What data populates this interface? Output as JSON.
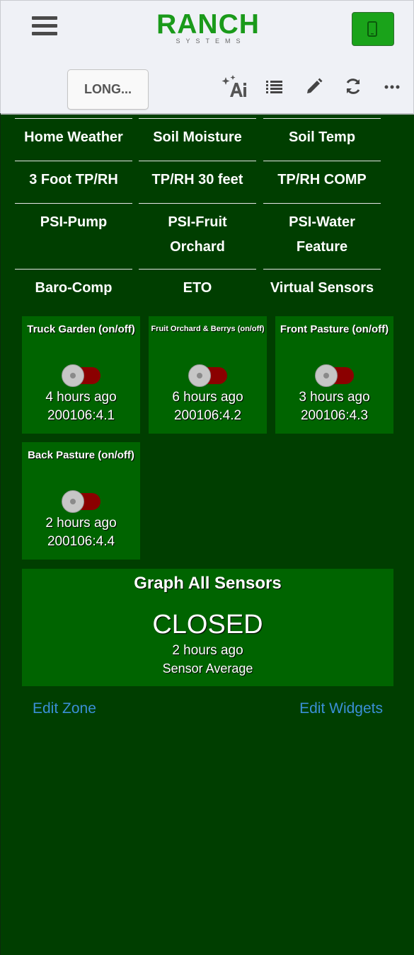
{
  "header": {
    "logo_main": "RANCH",
    "logo_sub": "SYSTEMS",
    "menu_icon": "hamburger-icon",
    "phone_icon": "mobile-phone-icon",
    "colors": {
      "logo": "#1a9a1a",
      "phone_button": "#1aa31a"
    }
  },
  "toolbar": {
    "selector_label": "LONG...",
    "icons": [
      "ai-sparkle-icon",
      "list-icon",
      "pencil-icon",
      "refresh-icon",
      "more-icon"
    ]
  },
  "nav": [
    [
      "Home Weather",
      "Soil Moisture",
      "Soil Temp"
    ],
    [
      "3 Foot TP/RH",
      "TP/RH 30 feet",
      "TP/RH COMP"
    ],
    [
      "PSI-Pump",
      "PSI-Fruit Orchard",
      "PSI-Water Feature"
    ],
    [
      "Baro-Comp",
      "ETO",
      "Virtual Sensors"
    ]
  ],
  "widgets": [
    {
      "title": "Truck Garden (on/off)",
      "state": "off",
      "time": "4 hours ago",
      "id": "200106:4.1"
    },
    {
      "title": "Fruit Orchard & Berrys (on/off)",
      "state": "off",
      "time": "6 hours ago",
      "id": "200106:4.2"
    },
    {
      "title": "Front Pasture (on/off)",
      "state": "off",
      "time": "3 hours ago",
      "id": "200106:4.3"
    },
    {
      "title": "Back Pasture (on/off)",
      "state": "off",
      "time": "2 hours ago",
      "id": "200106:4.4"
    }
  ],
  "graph": {
    "title": "Graph All Sensors",
    "state": "CLOSED",
    "time": "2 hours ago",
    "subtitle": "Sensor Average"
  },
  "links": {
    "edit_zone": "Edit Zone",
    "edit_widgets": "Edit Widgets"
  },
  "colors": {
    "background": "#003e00",
    "widget": "#006400",
    "toggle_off_track": "#8b0000",
    "link": "#3b8fd6"
  }
}
